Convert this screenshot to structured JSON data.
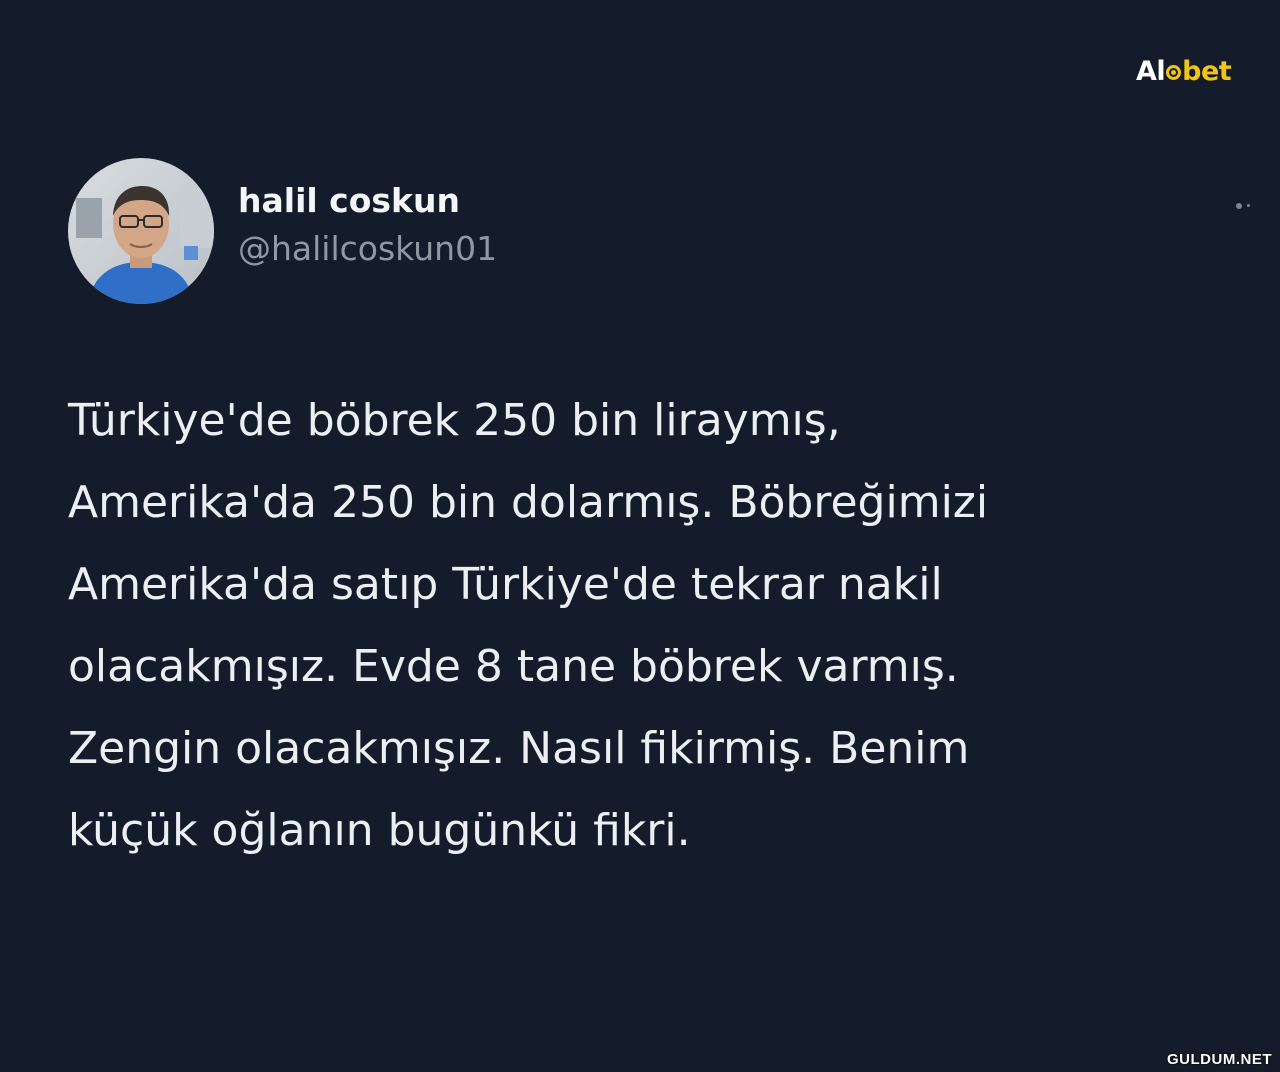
{
  "brand": {
    "logo_prefix": "Al",
    "logo_suffix": "bet",
    "accent_color": "#f0c419"
  },
  "tweet": {
    "author": {
      "display_name": "halil coskun",
      "handle": "@halilcoskun01",
      "avatar_icon": "profile-photo"
    },
    "more_icon": "more-options-icon",
    "text_lines": [
      "Türkiye'de böbrek 250 bin liraymış,",
      "Amerika'da 250 bin dolarmış. Böbreğimizi",
      "Amerika'da satıp Türkiye'de tekrar nakil",
      "olacakmışız. Evde 8 tane böbrek varmış.",
      "Zengin olacakmışız. Nasıl fikirmiş. Benim",
      "küçük oğlanın bugünkü fikri."
    ]
  },
  "watermark": {
    "text": "GULDUM.NET"
  },
  "colors": {
    "background": "#141c2b",
    "text": "#eceff2",
    "handle": "#8f98a3"
  }
}
